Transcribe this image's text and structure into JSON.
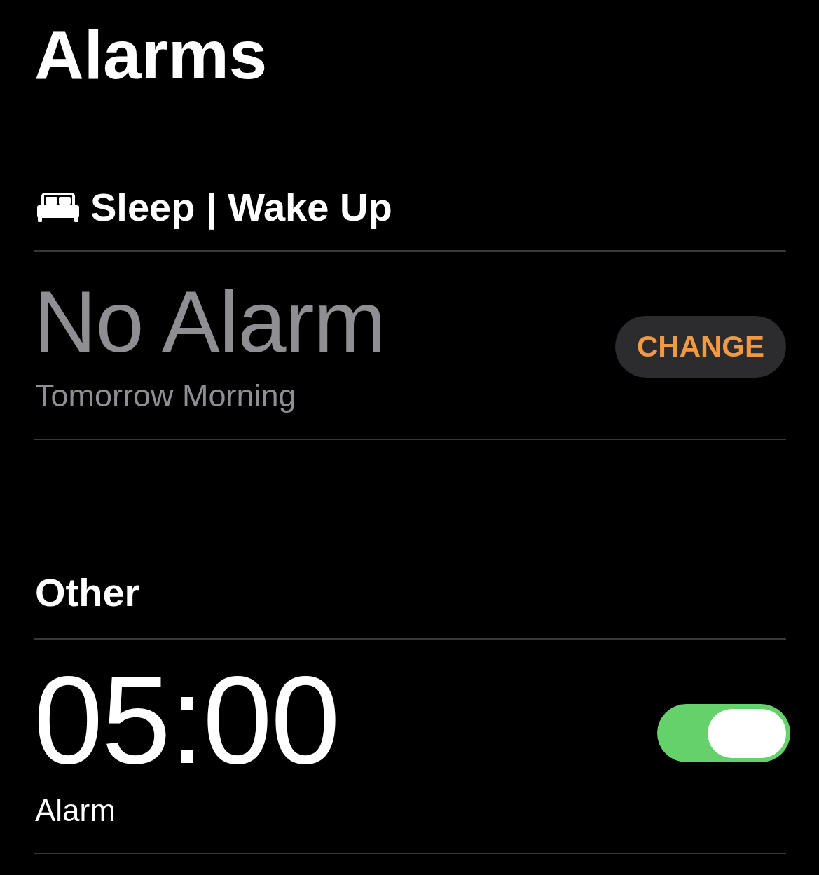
{
  "title": "Alarms",
  "sections": [
    {
      "kind": "sleep",
      "heading": "Sleep | Wake Up",
      "alarms": [
        {
          "kind": "sleep",
          "time": "No Alarm",
          "label": "Tomorrow Morning",
          "button": "CHANGE"
        }
      ]
    },
    {
      "kind": "other",
      "heading": "Other",
      "alarms": [
        {
          "kind": "switch",
          "time": "05:00",
          "label": "Alarm",
          "on": true
        }
      ]
    }
  ]
}
